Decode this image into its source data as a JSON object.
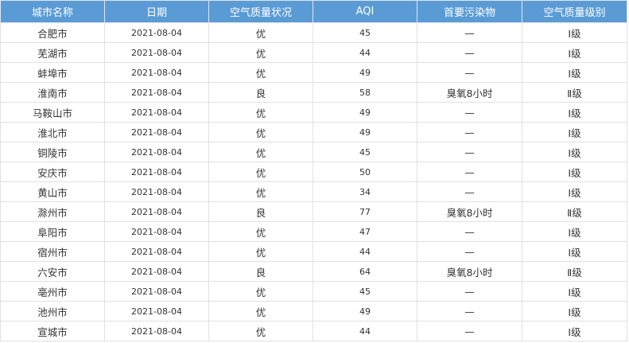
{
  "table": {
    "headers": [
      "城市名称",
      "日期",
      "空气质量状况",
      "AQI",
      "首要污染物",
      "空气质量级别"
    ],
    "rows": [
      {
        "city": "合肥市",
        "date": "2021-08-04",
        "status": "优",
        "aqi": "45",
        "pollutant": "—",
        "level": "Ⅰ级"
      },
      {
        "city": "芜湖市",
        "date": "2021-08-04",
        "status": "优",
        "aqi": "44",
        "pollutant": "—",
        "level": "Ⅰ级"
      },
      {
        "city": "蚌埠市",
        "date": "2021-08-04",
        "status": "优",
        "aqi": "49",
        "pollutant": "—",
        "level": "Ⅰ级"
      },
      {
        "city": "淮南市",
        "date": "2021-08-04",
        "status": "良",
        "aqi": "58",
        "pollutant": "臭氧8小时",
        "level": "Ⅱ级"
      },
      {
        "city": "马鞍山市",
        "date": "2021-08-04",
        "status": "优",
        "aqi": "49",
        "pollutant": "—",
        "level": "Ⅰ级"
      },
      {
        "city": "淮北市",
        "date": "2021-08-04",
        "status": "优",
        "aqi": "49",
        "pollutant": "—",
        "level": "Ⅰ级"
      },
      {
        "city": "铜陵市",
        "date": "2021-08-04",
        "status": "优",
        "aqi": "45",
        "pollutant": "—",
        "level": "Ⅰ级"
      },
      {
        "city": "安庆市",
        "date": "2021-08-04",
        "status": "优",
        "aqi": "50",
        "pollutant": "—",
        "level": "Ⅰ级"
      },
      {
        "city": "黄山市",
        "date": "2021-08-04",
        "status": "优",
        "aqi": "34",
        "pollutant": "—",
        "level": "Ⅰ级"
      },
      {
        "city": "滁州市",
        "date": "2021-08-04",
        "status": "良",
        "aqi": "77",
        "pollutant": "臭氧8小时",
        "level": "Ⅱ级"
      },
      {
        "city": "阜阳市",
        "date": "2021-08-04",
        "status": "优",
        "aqi": "47",
        "pollutant": "—",
        "level": "Ⅰ级"
      },
      {
        "city": "宿州市",
        "date": "2021-08-04",
        "status": "优",
        "aqi": "44",
        "pollutant": "—",
        "level": "Ⅰ级"
      },
      {
        "city": "六安市",
        "date": "2021-08-04",
        "status": "良",
        "aqi": "64",
        "pollutant": "臭氧8小时",
        "level": "Ⅱ级"
      },
      {
        "city": "亳州市",
        "date": "2021-08-04",
        "status": "优",
        "aqi": "45",
        "pollutant": "—",
        "level": "Ⅰ级"
      },
      {
        "city": "池州市",
        "date": "2021-08-04",
        "status": "优",
        "aqi": "49",
        "pollutant": "—",
        "level": "Ⅰ级"
      },
      {
        "city": "宣城市",
        "date": "2021-08-04",
        "status": "优",
        "aqi": "44",
        "pollutant": "—",
        "level": "Ⅰ级"
      }
    ]
  },
  "colors": {
    "header_bg": "#5a9bd5",
    "header_text": "#ffffff",
    "grid": "#e1e1e1",
    "cell_text": "#333333"
  }
}
